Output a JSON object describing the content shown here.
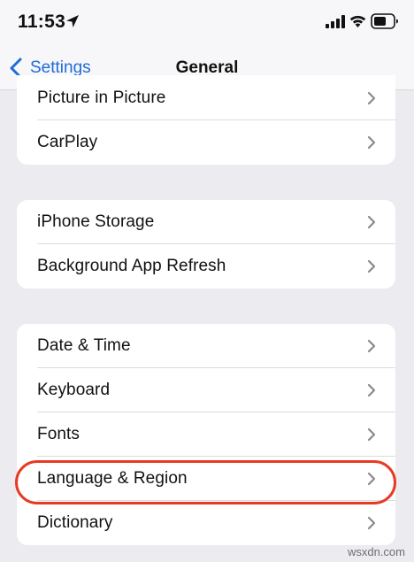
{
  "status_bar": {
    "time": "11:53",
    "icons": [
      "location-icon",
      "signal-icon",
      "wifi-icon",
      "battery-icon"
    ]
  },
  "nav_bar": {
    "back_label": "Settings",
    "title": "General",
    "accent_color": "#1f6bd8"
  },
  "groups": [
    {
      "rows": [
        {
          "label": "Picture in Picture"
        },
        {
          "label": "CarPlay"
        }
      ]
    },
    {
      "rows": [
        {
          "label": "iPhone Storage"
        },
        {
          "label": "Background App Refresh"
        }
      ]
    },
    {
      "rows": [
        {
          "label": "Date & Time"
        },
        {
          "label": "Keyboard"
        },
        {
          "label": "Fonts"
        },
        {
          "label": "Language & Region",
          "highlighted": true
        },
        {
          "label": "Dictionary"
        }
      ]
    }
  ],
  "highlight_color": "#e83a23",
  "watermark": "wsxdn.com"
}
